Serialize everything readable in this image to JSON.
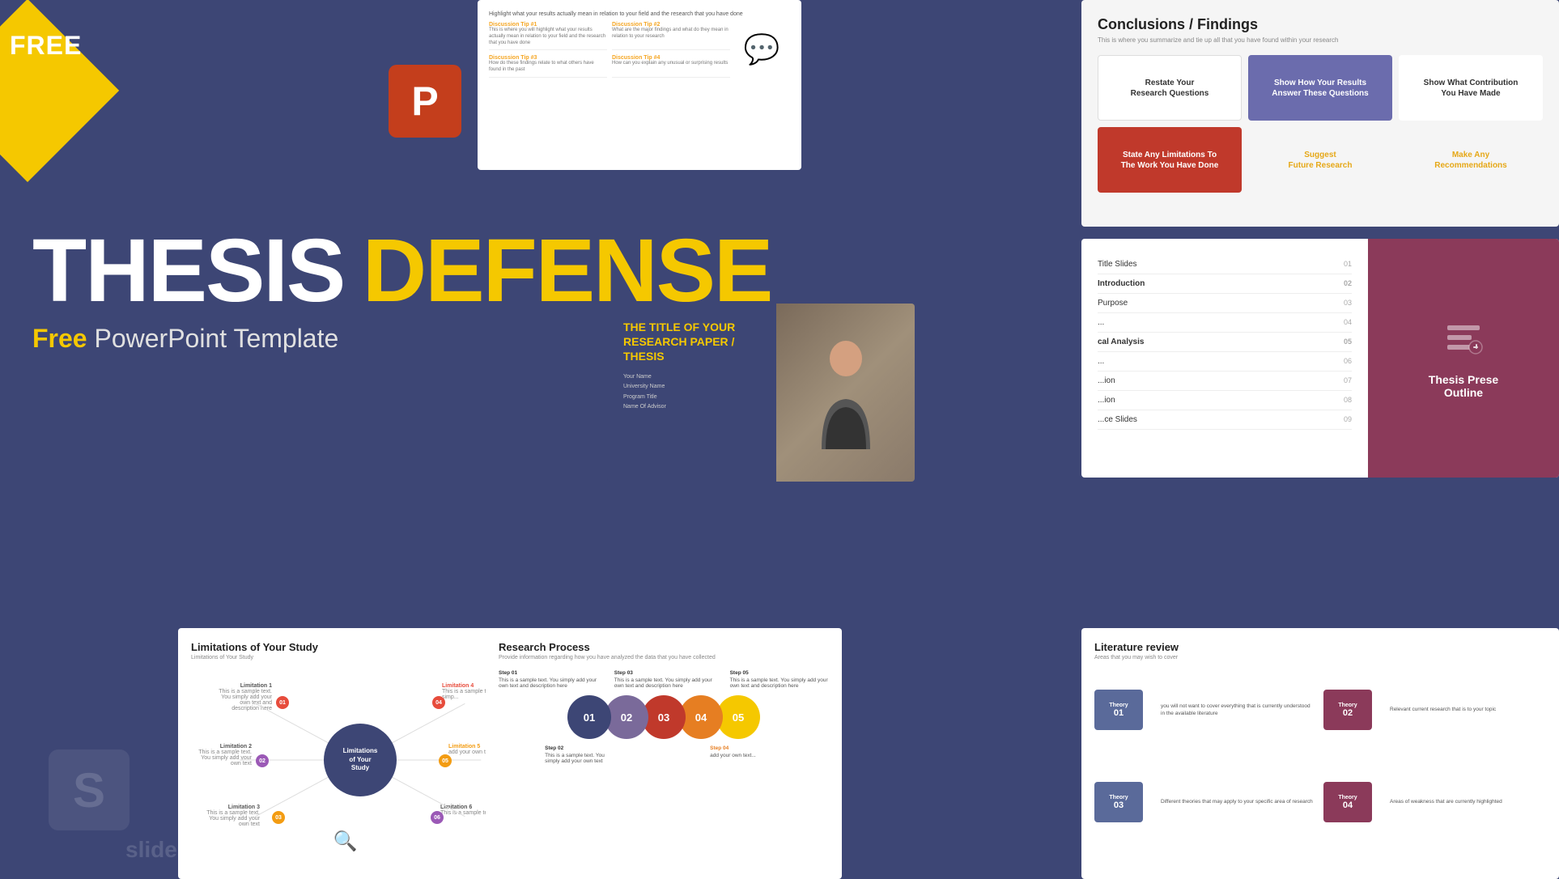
{
  "badge": {
    "label": "FREE"
  },
  "main_title": {
    "thesis": "THESIS",
    "defense": "DEFENSE",
    "subtitle_free": "Free",
    "subtitle_rest": " PowerPoint Template"
  },
  "watermark": {
    "text": "slidesalad"
  },
  "card_discussion": {
    "header": "Highlight what your results actually mean in relation to your field and the research that you have done",
    "tips": [
      {
        "title": "Discussion Tip #1",
        "text": "This is where you will highlight what your results actually mean in relation to your field and the research that you have done"
      },
      {
        "title": "Discussion Tip #2",
        "text": "What are the major findings and what do they mean in relation to your research"
      },
      {
        "title": "Discussion Tip #3",
        "text": "How do these findings relate to what others have found in the past"
      },
      {
        "title": "Discussion Tip #4",
        "text": "How can you explain any unusual or surprising results"
      }
    ]
  },
  "card_conclusions": {
    "title": "Conclusions / Findings",
    "subtitle": "This is where you summarize and tie up all that you have found within your research",
    "cells": [
      {
        "text": "Restate Your Research Questions",
        "style": "white"
      },
      {
        "text": "Show How Your Results Answer These Questions",
        "style": "purple"
      },
      {
        "text": "Show What Contribution You Have Made",
        "style": "white"
      },
      {
        "text": "State Any Limitations To The Work You Have Done",
        "style": "red"
      },
      {
        "text": "Suggest Future Research",
        "style": "gold"
      },
      {
        "text": "Make Any Recommendations",
        "style": "gold"
      }
    ]
  },
  "card_outline": {
    "title": "Thesis Presentation Outline",
    "items": [
      {
        "label": "Title Slides",
        "num": "01"
      },
      {
        "label": "Introduction",
        "num": "02"
      },
      {
        "label": "Purpose",
        "num": "03"
      },
      {
        "label": "...",
        "num": "04"
      },
      {
        "label": "cal Analysis",
        "num": "05"
      },
      {
        "label": "...",
        "num": "06"
      },
      {
        "label": "...ion",
        "num": "07"
      },
      {
        "label": "...ion",
        "num": "08"
      },
      {
        "label": "...ce Slides",
        "num": "09"
      }
    ]
  },
  "card_title_slide": {
    "title": "THE TITLE OF YOUR RESEARCH PAPER / THESIS",
    "your_name": "Your Name",
    "university": "University Name",
    "program": "Program Title",
    "advisor": "Name Of Advisor"
  },
  "card_limitations": {
    "title": "Limitations of Your Study",
    "subtitle": "Limitations of Your Study",
    "center_label": "Limitations of Your Study",
    "nodes": [
      {
        "label": "Limitation 1",
        "num": "01",
        "color": "#e74c3c"
      },
      {
        "label": "Limitation 2",
        "num": "02",
        "color": "#9b59b6"
      },
      {
        "label": "Limitation 3",
        "num": "03",
        "color": "#f39c12"
      },
      {
        "label": "Limitation 4",
        "num": "04",
        "color": "#e74c3c"
      },
      {
        "label": "Limitation 5",
        "num": "05",
        "color": "#f39c12"
      },
      {
        "label": "Limitation 6",
        "num": "06",
        "color": "#9b59b6"
      }
    ]
  },
  "card_research": {
    "title": "Research Process",
    "subtitle": "Provide information regarding how you have analyzed the data that you have collected",
    "steps": [
      {
        "num": "Step 01",
        "text": "This is a sample text. You simply add your own text and description here"
      },
      {
        "num": "Step 03",
        "text": "This is a sample text. You simply add your own text and description here"
      },
      {
        "num": "Step 05",
        "text": "This is a sample text. You simply add your own text and description here"
      },
      {
        "num": "Step 02",
        "text": ""
      },
      {
        "num": "Step 04",
        "text": ""
      }
    ],
    "circles": [
      {
        "num": "01",
        "color": "#3d4675"
      },
      {
        "num": "02",
        "color": "#7a6a9a"
      },
      {
        "num": "03",
        "color": "#c0392b"
      },
      {
        "num": "04",
        "color": "#e67e22"
      },
      {
        "num": "05",
        "color": "#f5c800"
      }
    ]
  },
  "card_literature": {
    "title": "Literature review",
    "subtitle": "Areas that you may wish to cover",
    "theories": [
      {
        "label": "Theory 01",
        "color": "#5a6a9a",
        "text": "you will not want to cover everything that is currently understood in the available literature"
      },
      {
        "label": "Theory 02",
        "color": "#8b3a5a",
        "text": "Relevant current research that is to your topic"
      },
      {
        "label": "Theory 03",
        "color": "#5a6a9a",
        "text": "Different theories that may apply to your specific area of research"
      },
      {
        "label": "Theory 04",
        "color": "#8b3a5a",
        "text": "Areas of weakness that are currently highlighted"
      }
    ]
  }
}
